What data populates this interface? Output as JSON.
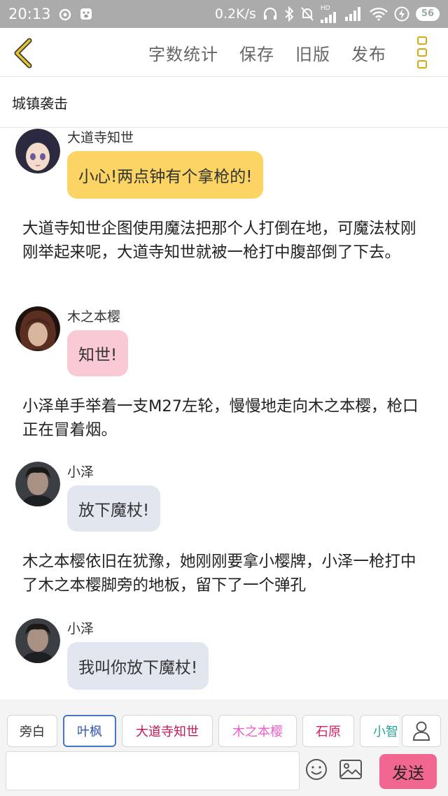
{
  "status_bar": {
    "time": "20:13",
    "net_speed": "0.2K/s",
    "battery": "56",
    "hd_label": "HD",
    "icons": [
      "weibo-icon",
      "baidu-icon",
      "headphones-icon",
      "bluetooth-icon",
      "alarm-off-icon",
      "signal-icon",
      "signal-icon",
      "wifi-icon",
      "charging-icon",
      "battery-icon"
    ]
  },
  "toolbar": {
    "back_icon": "chevron-left-icon",
    "word_count": "字数统计",
    "save": "保存",
    "old_version": "旧版",
    "publish": "发布",
    "menu_icon": "more-vertical-icon",
    "accent_color": "#d1ab16"
  },
  "title": "城镇袭击",
  "messages": [
    {
      "type": "dialogue",
      "speaker": "大道寺知世",
      "text": "小心!两点钟有个拿枪的!",
      "bubble_color": "#fbd463"
    },
    {
      "type": "narration",
      "text": "大道寺知世企图使用魔法把那个人打倒在地，可魔法杖刚刚举起来呢，大道寺知世就被一枪打中腹部倒了下去。"
    },
    {
      "type": "dialogue",
      "speaker": "木之本樱",
      "text": "知世!",
      "bubble_color": "#f9c9d5"
    },
    {
      "type": "narration",
      "text": "小泽单手举着一支M27左轮，慢慢地走向木之本樱，枪口正在冒着烟。"
    },
    {
      "type": "dialogue",
      "speaker": "小泽",
      "text": "放下魔杖!",
      "bubble_color": "#e1e6ef"
    },
    {
      "type": "narration",
      "text": "木之本樱依旧在犹豫，她刚刚要拿小樱牌，小泽一枪打中了木之本樱脚旁的地板，留下了一个弹孔"
    },
    {
      "type": "dialogue",
      "speaker": "小泽",
      "text": "我叫你放下魔杖!",
      "bubble_color": "#e1e6ef"
    }
  ],
  "characters": [
    {
      "label": "旁白",
      "color": "#333333",
      "selected": false
    },
    {
      "label": "叶枫",
      "color": "#2f55b4",
      "selected": true
    },
    {
      "label": "大道寺知世",
      "color": "#c2185b",
      "selected": false
    },
    {
      "label": "木之本樱",
      "color": "#ea5fc8",
      "selected": false
    },
    {
      "label": "石原",
      "color": "#d81b60",
      "selected": false
    },
    {
      "label": "小智",
      "color": "#26a69a",
      "selected": false
    }
  ],
  "composer": {
    "input_value": "",
    "input_placeholder": "",
    "send_label": "发送",
    "send_color": "#f2678f"
  }
}
